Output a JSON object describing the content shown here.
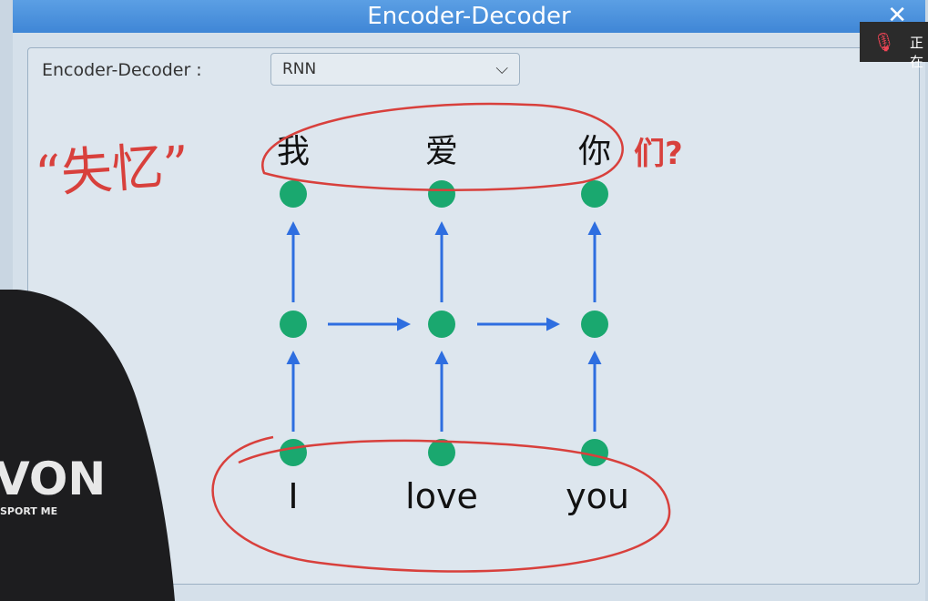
{
  "window": {
    "title": "Encoder-Decoder",
    "close_symbol": "✕"
  },
  "form": {
    "label": "Encoder-Decoder :",
    "selected": "RNN",
    "chevron": "⌵"
  },
  "diagram": {
    "output_words": [
      "我",
      "爱",
      "你"
    ],
    "output_suffix": "们?",
    "input_words": [
      "I",
      "love",
      "you"
    ],
    "node_color": "#1aa86f",
    "arrow_color": "#2e6ee0",
    "annotation_color": "#d8403c"
  },
  "annotation": {
    "handwritten": "“失忆”"
  },
  "overlay": {
    "mic_text": "正在"
  },
  "presenter": {
    "shirt_text": "VON",
    "shirt_subtext": "SPORT ME"
  }
}
